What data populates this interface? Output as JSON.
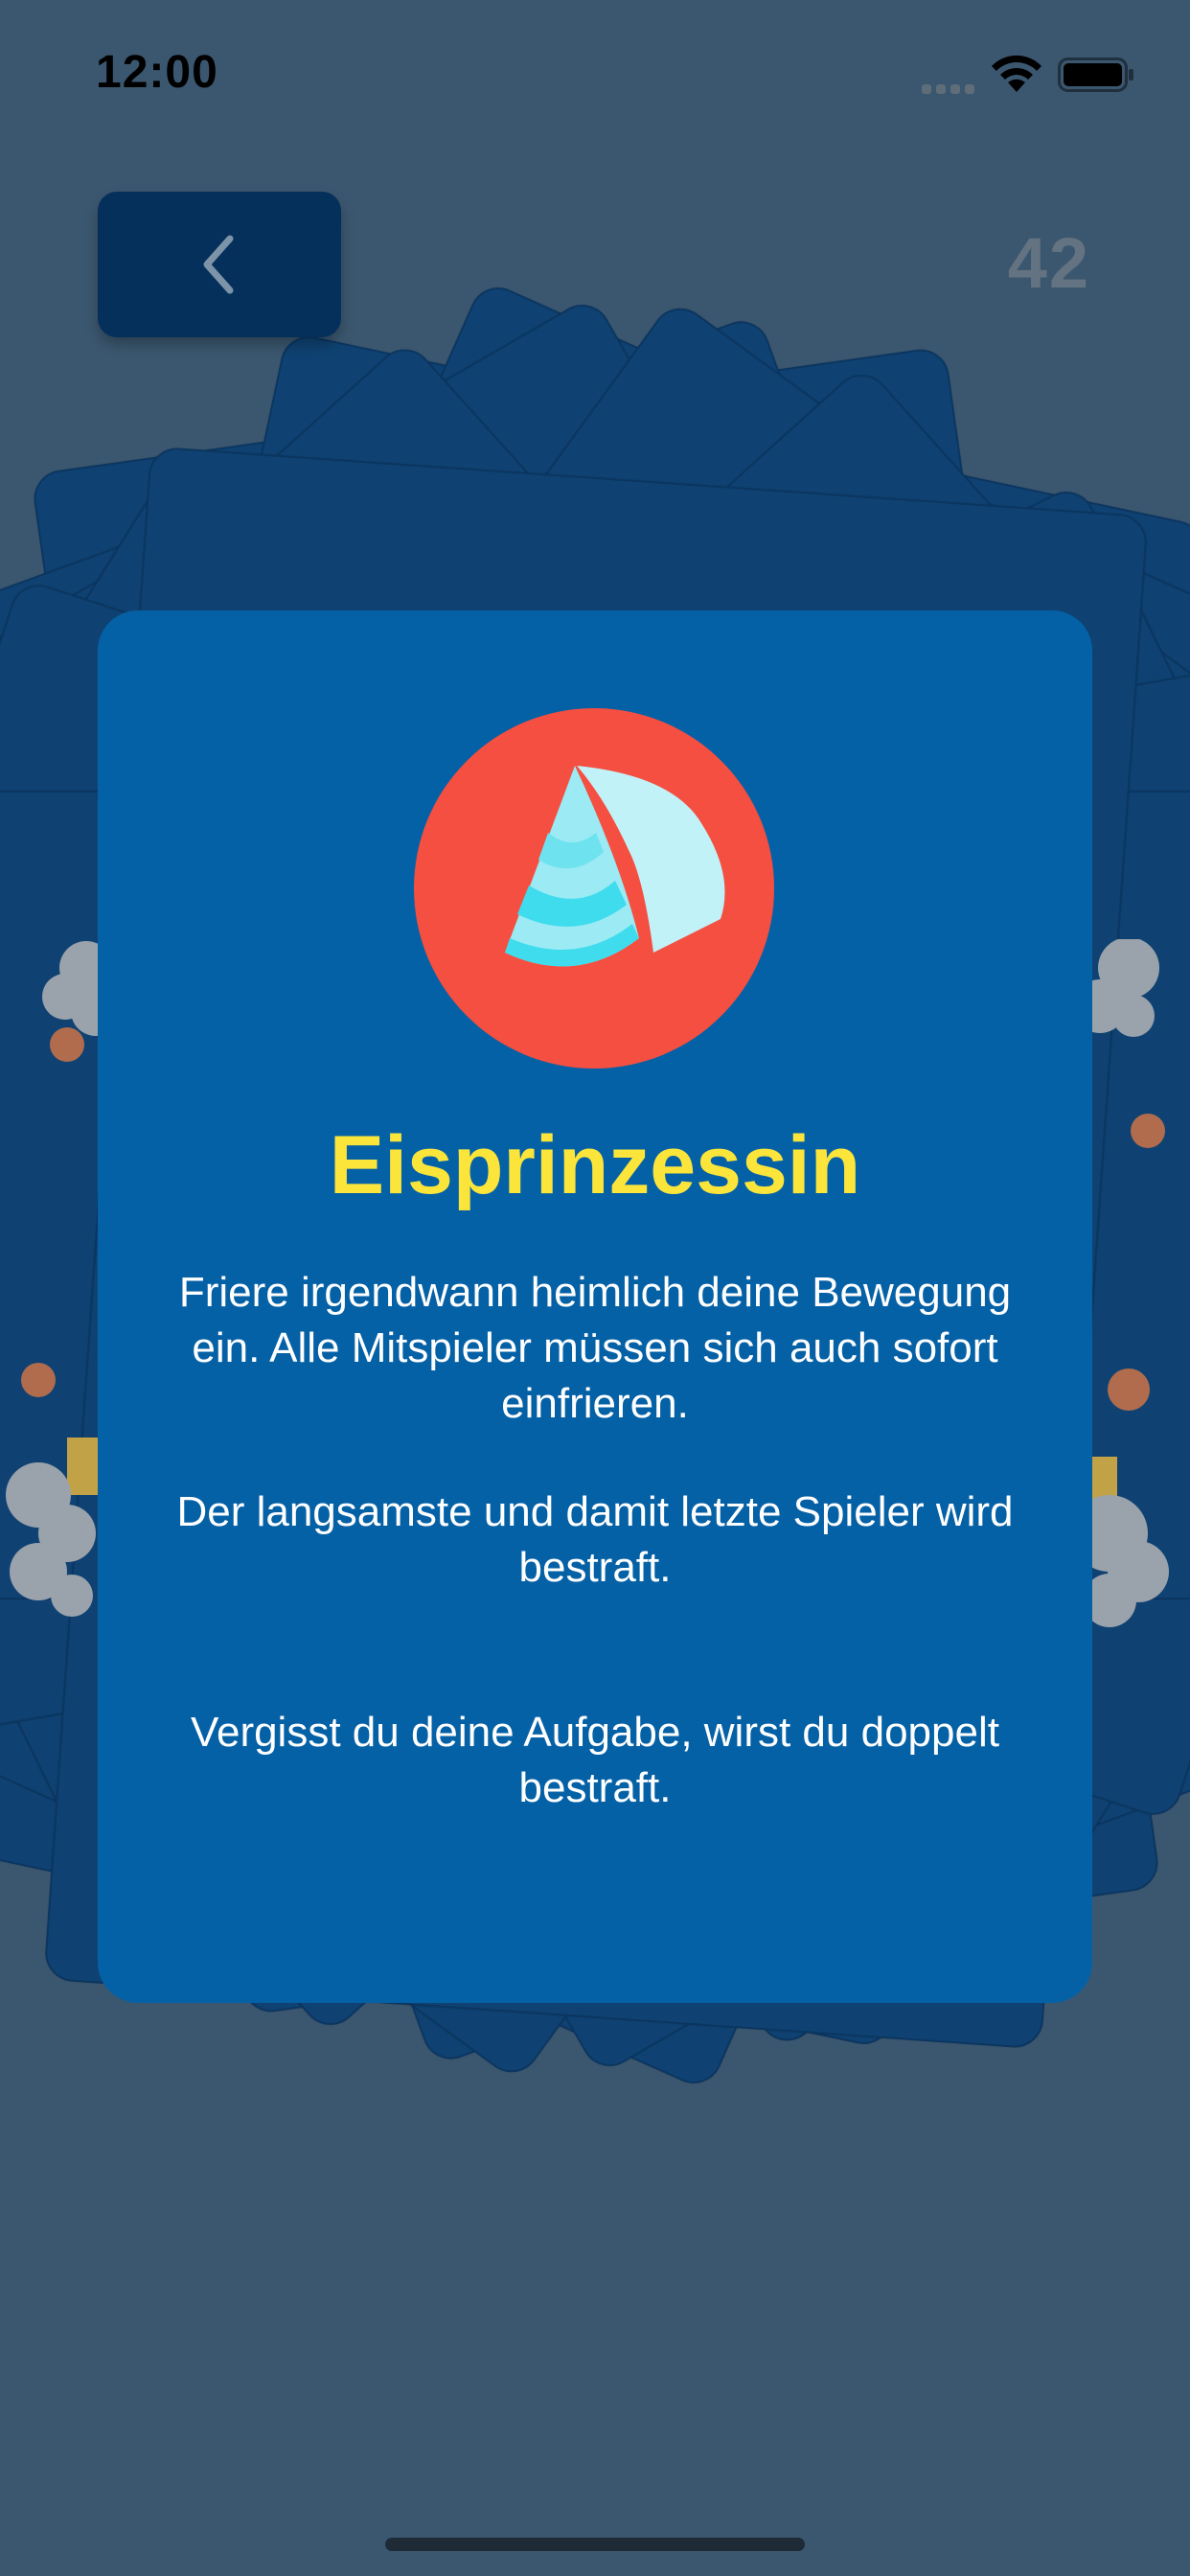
{
  "status_bar": {
    "time": "12:00"
  },
  "header": {
    "back_icon": "chevron-left-icon",
    "card_count": "42"
  },
  "card": {
    "emblem_icon": "ice-crystal-icon",
    "title": "Eisprinzessin",
    "paragraphs": [
      "Friere irgendwann heimlich deine Bewegung ein. Alle Mitspieler müssen sich auch sofort einfrieren.",
      "Der langsamste und damit letzte Spieler wird bestraft.",
      "Vergisst du deine Aufgabe, wirst du doppelt bestraft."
    ]
  },
  "colors": {
    "background": "#3b576f",
    "card": "#0561a6",
    "deck_card": "#0f4272",
    "back_button": "#04305b",
    "title": "#fbe53b",
    "emblem": "#f44f40",
    "counter": "#637381"
  }
}
